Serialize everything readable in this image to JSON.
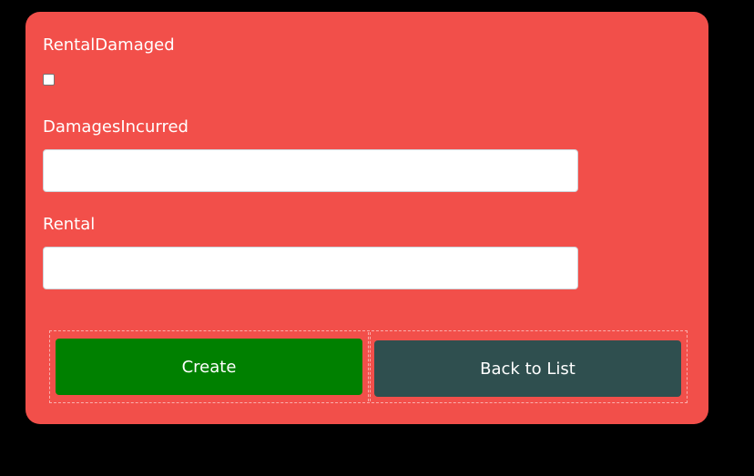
{
  "form": {
    "rental_damaged_label": "RentalDamaged",
    "rental_damaged_checked": false,
    "damages_incurred_label": "DamagesIncurred",
    "damages_incurred_value": "",
    "rental_label": "Rental",
    "rental_value": ""
  },
  "actions": {
    "create_label": "Create",
    "back_label": "Back to List"
  },
  "colors": {
    "page_background": "#000000",
    "card_background": "#f24f4a",
    "create_button": "#008000",
    "back_button": "#2f4f4f"
  }
}
